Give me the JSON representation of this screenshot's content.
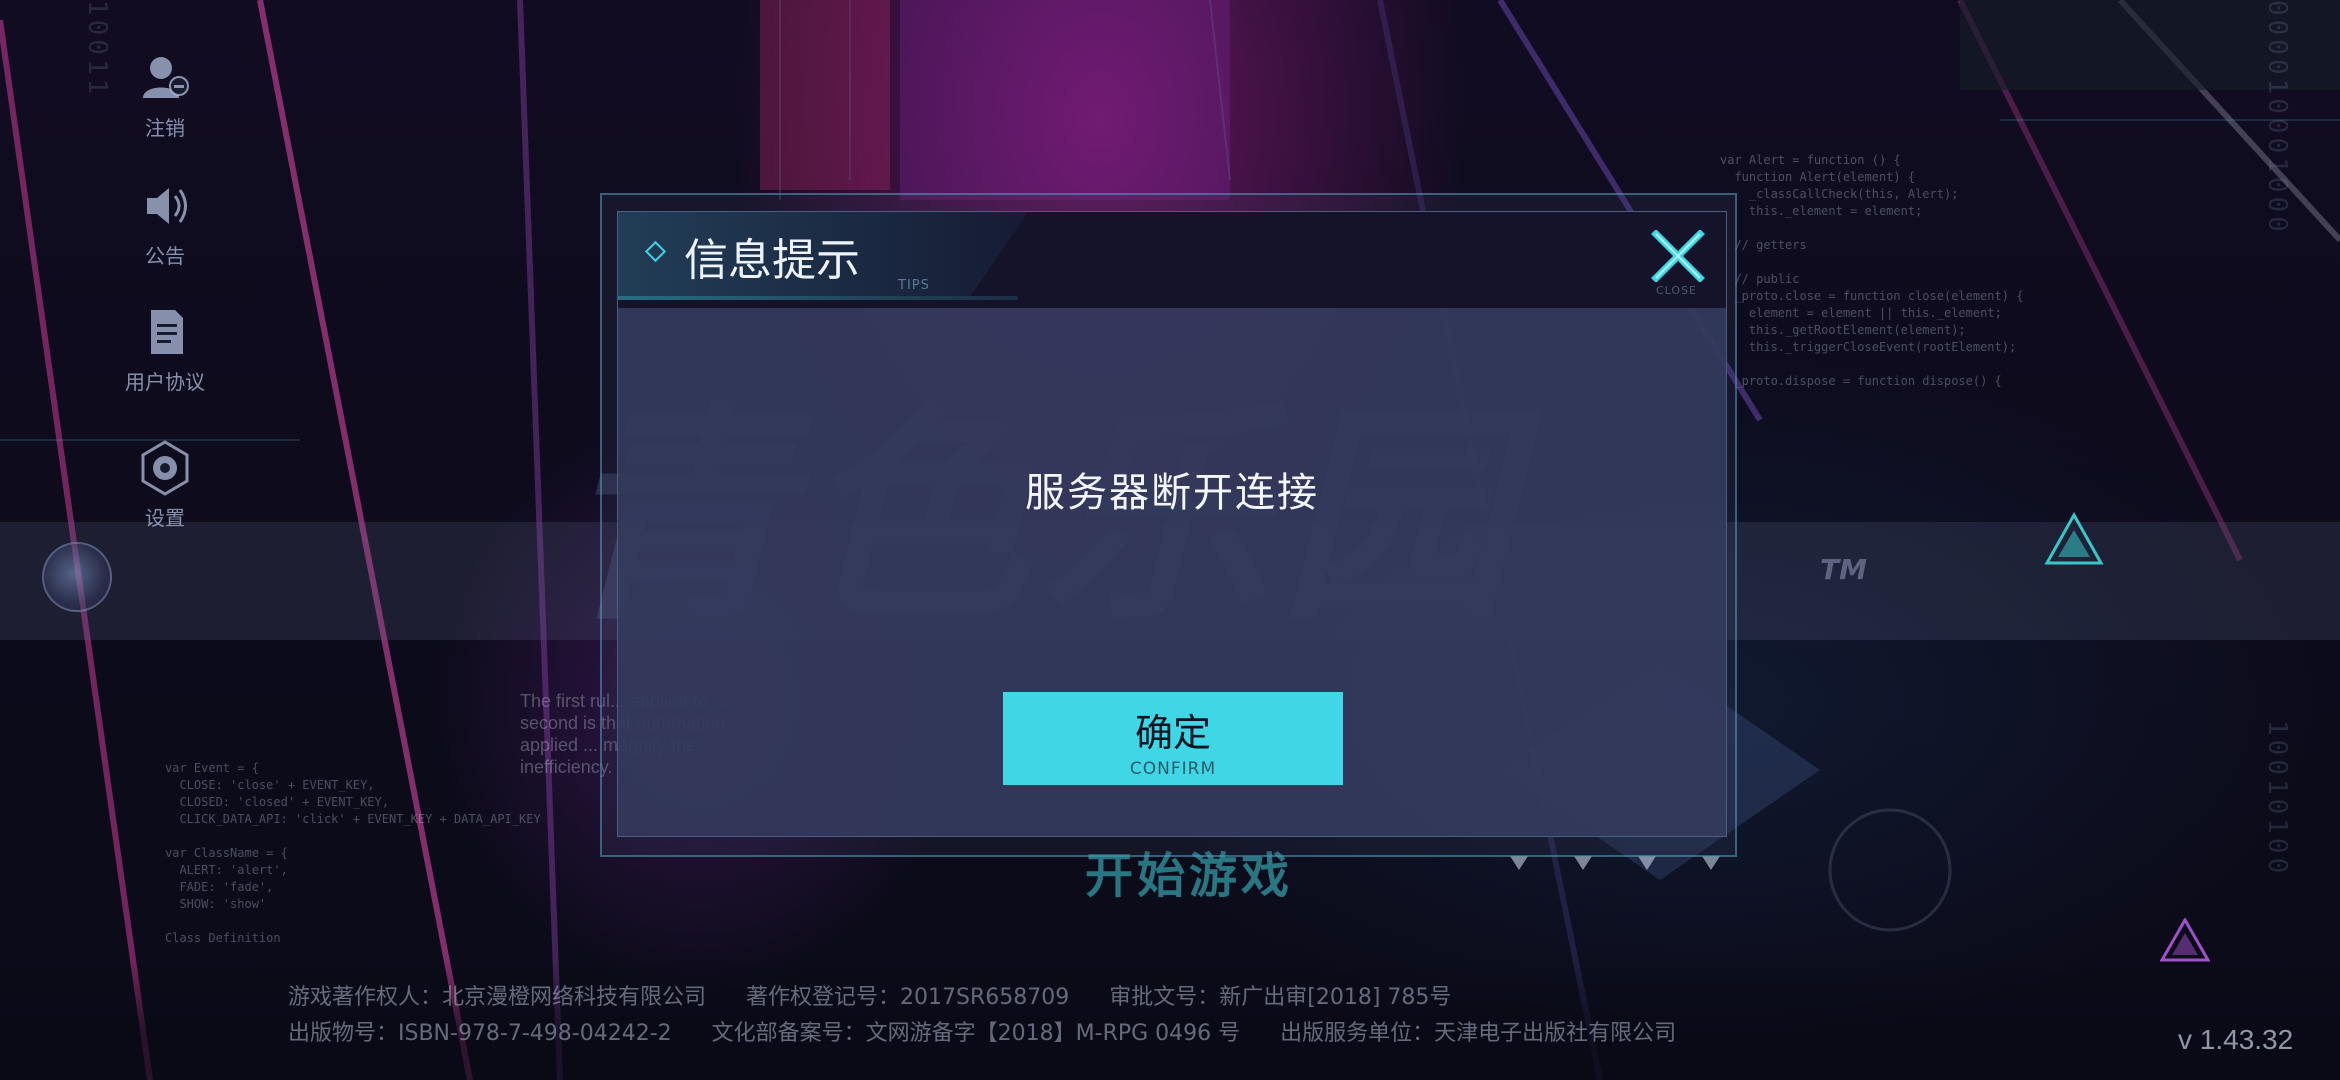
{
  "sidebar": {
    "items": [
      {
        "label": "注销",
        "icon": "logout-user-icon"
      },
      {
        "label": "公告",
        "icon": "speaker-icon"
      },
      {
        "label": "用户协议",
        "icon": "document-icon"
      },
      {
        "label": "设置",
        "icon": "gear-icon"
      }
    ]
  },
  "background": {
    "start_game_label": "开始游戏",
    "tm_mark": "TM",
    "faint_quote": "The first rul... applied to ... second is that automation applied ... magnify the inefficiency."
  },
  "dialog": {
    "title": "信息提示",
    "tips_tag": "TIPS",
    "close_sub": "CLOSE",
    "message": "服务器断开连接",
    "confirm_label": "确定",
    "confirm_sub": "CONFIRM"
  },
  "footer": {
    "line1": {
      "copyright_holder": "游戏著作权人：北京漫橙网络科技有限公司",
      "copyright_reg": "著作权登记号：2017SR658709",
      "approval_no": "审批文号：新广出审[2018] 785号"
    },
    "line2": {
      "publication_no": "出版物号：ISBN-978-7-498-04242-2",
      "culture_record": "文化部备案号：文网游备字【2018】M-RPG 0496 号",
      "publisher": "出版服务单位：天津电子出版社有限公司"
    }
  },
  "version": "v 1.43.32",
  "colors": {
    "accent_cyan": "#3fd7e6",
    "dialog_body": "#343a5c",
    "dialog_header": "#14132a"
  }
}
